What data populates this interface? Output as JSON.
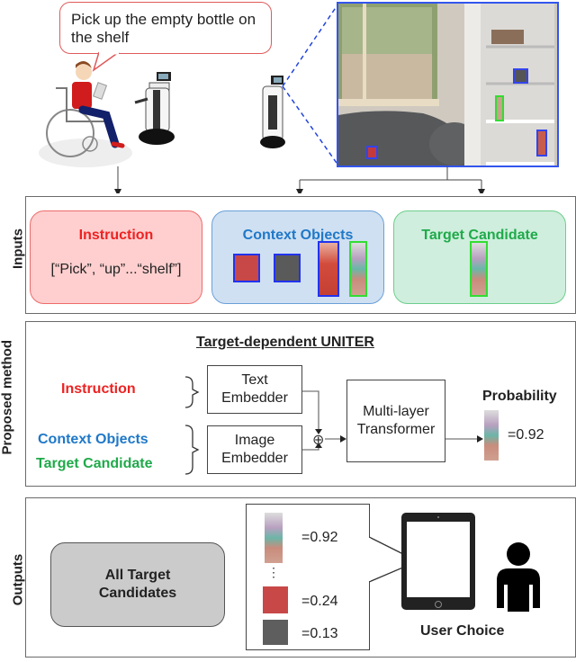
{
  "scene": {
    "speech_bubble": "Pick up the empty bottle on the shelf",
    "actors": [
      "user-in-wheelchair-with-tablet",
      "robot-near-user",
      "robot-facing-scene"
    ],
    "camera_view_boxes": [
      {
        "object": "tissue-box",
        "color": "#3344ee"
      },
      {
        "object": "bottle-target",
        "color": "#33dd33"
      },
      {
        "object": "ketchup-bottle",
        "color": "#3344ee"
      },
      {
        "object": "red-cup",
        "color": "#3344ee"
      }
    ]
  },
  "inputs": {
    "section_label": "Inputs",
    "instruction": {
      "title": "Instruction",
      "tokens": "[“Pick”, “up”...“shelf”]",
      "color": "#ee2222",
      "fill": "#ffcfcf",
      "border": "#ee6b6b"
    },
    "context_objects": {
      "title": "Context Objects",
      "color": "#1f78c8",
      "fill": "#cfe0f2",
      "border": "#6aa0d8"
    },
    "target_candidate": {
      "title": "Target Candidate",
      "color": "#1faa4a",
      "fill": "#cfeedd",
      "border": "#6ccf8c"
    }
  },
  "method": {
    "section_label": "Proposed method",
    "title": "Target-dependent UNITER",
    "instruction_label": "Instruction",
    "context_label": "Context Objects",
    "target_label": "Target Candidate",
    "text_embedder": "Text Embedder",
    "image_embedder": "Image Embedder",
    "transformer": "Multi-layer Transformer",
    "probability_label": "Probability",
    "probability_value": "=0.92",
    "sum_symbol": "⊕"
  },
  "outputs": {
    "section_label": "Outputs",
    "all_candidates": "All Target Candidates",
    "ranking": [
      {
        "object": "bottle",
        "value": "=0.92"
      },
      {
        "object": "red-cup",
        "value": "=0.24"
      },
      {
        "object": "tissue-box",
        "value": "=0.13"
      }
    ],
    "ellipsis": "⋮",
    "user_choice": "User Choice"
  }
}
